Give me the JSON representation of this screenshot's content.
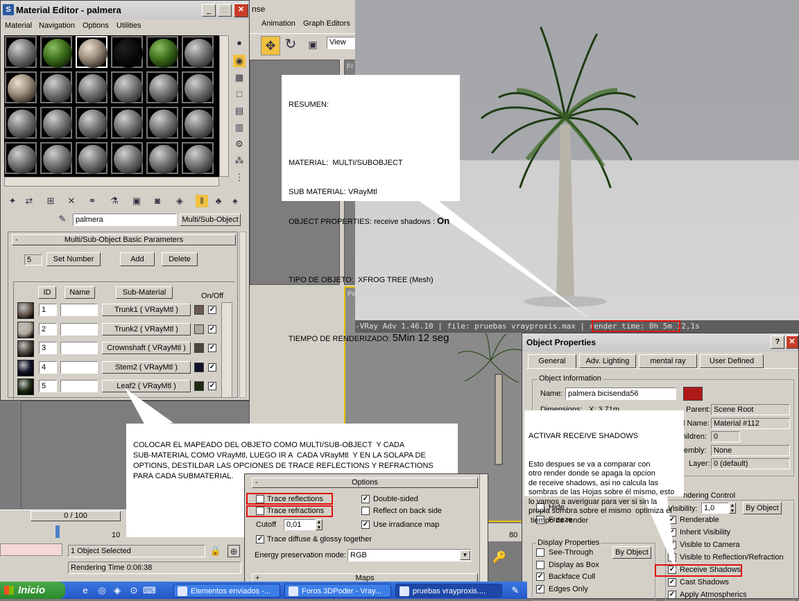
{
  "material_editor": {
    "title": "Material Editor - palmera",
    "menu": [
      "Material",
      "Navigation",
      "Options",
      "Utilities"
    ],
    "material_name": "palmera",
    "material_type": "Multi/Sub-Object",
    "rollout_title": "Multi/Sub-Object Basic Parameters",
    "num_materials": "5",
    "set_number": "Set Number",
    "add": "Add",
    "delete": "Delete",
    "col_id": "ID",
    "col_name": "Name",
    "col_submaterial": "Sub-Material",
    "col_onoff": "On/Off",
    "rows": [
      {
        "id": "1",
        "sub": "Trunk1  ( VRayMtl )",
        "color": "#6a5a50"
      },
      {
        "id": "2",
        "sub": "Trunk2  ( VRayMtl )",
        "color": "#b0a898"
      },
      {
        "id": "3",
        "sub": "Crownshaft  ( VRayMtl )",
        "color": "#4a463c"
      },
      {
        "id": "4",
        "sub": "Stem2  ( VRayMtl )",
        "color": "#10102a"
      },
      {
        "id": "5",
        "sub": "Leaf2  ( VRayMtl )",
        "color": "#1c2a10"
      }
    ]
  },
  "max": {
    "menu_partial": "nse",
    "menu": [
      "Animation",
      "Graph Editors"
    ],
    "view_dropdown": "View",
    "frame_counter": "0 / 100",
    "ruler_ticks": [
      "10",
      "80"
    ],
    "status": "1 Object Selected",
    "rendering_time": "Rendering Time  0:06:38",
    "viewport_labels": [
      "Fr",
      "Pe"
    ]
  },
  "render_window": {
    "status_bar": "-VRay Adv 1.46.10 | file: pruebas vrayproxis.max  | render time: 0h 5m 12,1s"
  },
  "note_summary": {
    "line1": "RESUMEN:",
    "line2": "MATERIAL:  MULTI/SUBOBJECT",
    "line3": "SUB MATERIAL: VRayMtl",
    "line4": "OBJECT PROPERTIES: receive shadows : ",
    "line4_bold": "On",
    "line5": "TIPO DE OBJETO:  XFROG TREE (Mesh)",
    "line6": "TIEMPO DE RENDERIZADO: ",
    "line6_big": "5Min 12 seg"
  },
  "note_material": "COLOCAR EL MAPEADO DEL OBJETO COMO MULTI/SUB-OBJECT  Y CADA\nSUB-MATERIAL COMO VRayMtl, LUEGO IR A  CADA VRayMtl  Y EN LA SOLAPA DE\nOPTIONS, DESTILDAR LAS OPCIONES DE TRACE REFLECTIONS Y REFRACTIONS\nPARA CADA SUBMATERIAL.",
  "note_shadows": {
    "title": "ACTIVAR RECEIVE SHADOWS",
    "body": "Esto despues se va a comparar con\notro render donde se apaga la opcion\nde receive shadows, asi no calcula las\nsombras de las Hojas sobre él mismo, esto\nlo vamos a averiguar para ver si sin la\npropia sombra sobre el mismo  optimiza el\n tiempo de render"
  },
  "options_rollout": {
    "title": "Options",
    "minus": "-",
    "trace_reflections": "Trace reflections",
    "trace_refractions": "Trace refractions",
    "double_sided": "Double-sided",
    "reflect_back": "Reflect on back side",
    "cutoff_label": "Cutoff",
    "cutoff_value": "0,01",
    "use_irradiance": "Use irradiance map",
    "trace_diffuse": "Trace diffuse & glossy together",
    "energy_label": "Energy preservation mode:",
    "energy_value": "RGB",
    "maps": "Maps",
    "plus": "+"
  },
  "object_properties": {
    "title": "Object Properties",
    "tabs": [
      "General",
      "Adv. Lighting",
      "mental ray",
      "User Defined"
    ],
    "object_information": "Object Information",
    "name_label": "Name:",
    "name_value": "palmera bicisenda56",
    "color": "#b01818",
    "dimensions_label": "Dimensions:",
    "dim_value": "X: 3,71m",
    "parent_label": "Parent:",
    "parent_value": "Scene Root",
    "material_label": "l Name:",
    "material_value": "Material #112",
    "children_label": "Children:",
    "children_value": "0",
    "assembly_label": "ssembly:",
    "assembly_value": "None",
    "layer_label": "Layer:",
    "layer_value": "0 (default)",
    "hide": "Hide",
    "freeze": "Freeze",
    "display_properties": "Display Properties",
    "see_through": "See-Through",
    "display_as_box": "Display as Box",
    "backface_cull": "Backface Cull",
    "edges_only": "Edges Only",
    "by_object": "By Object",
    "rendering_control": "ndering Control",
    "visibility_label": "Visibility:",
    "visibility_value": "1,0",
    "renderable": "Renderable",
    "inherit_visibility": "Inherit Visibility",
    "visible_camera": "Visible to Camera",
    "visible_reflection": "Visible to Reflection/Refraction",
    "receive_shadows": "Receive Shadows",
    "cast_shadows": "Cast Shadows",
    "apply_atmospherics": "Apply Atmospherics"
  },
  "taskbar": {
    "start": "Inicio",
    "tasks": [
      "Elementos enviados -...",
      "Foros 3DPoder - Vray...",
      "pruebas vrayproxis...."
    ]
  }
}
